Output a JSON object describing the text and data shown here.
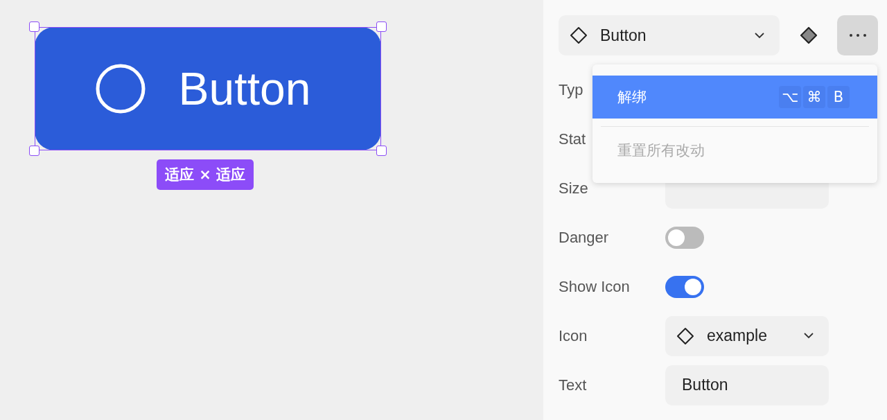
{
  "canvas": {
    "component": {
      "text": "Button",
      "show_icon": true
    },
    "size_badge": "适应 × 适应"
  },
  "panel": {
    "component_select": {
      "value": "Button"
    },
    "properties": [
      {
        "label": "Typ",
        "kind": "covered"
      },
      {
        "label": "Stat",
        "kind": "covered"
      },
      {
        "label": "Size",
        "kind": "select"
      },
      {
        "label": "Danger",
        "kind": "toggle",
        "on": false
      },
      {
        "label": "Show Icon",
        "kind": "toggle",
        "on": true
      },
      {
        "label": "Icon",
        "kind": "select",
        "value": "example"
      },
      {
        "label": "Text",
        "kind": "input",
        "value": "Button"
      }
    ],
    "menu": {
      "items": [
        {
          "label": "解绑",
          "selected": true,
          "disabled": false,
          "shortcut": [
            "⌥",
            "⌘",
            "B"
          ]
        },
        {
          "label": "重置所有改动",
          "selected": false,
          "disabled": true
        }
      ]
    }
  }
}
